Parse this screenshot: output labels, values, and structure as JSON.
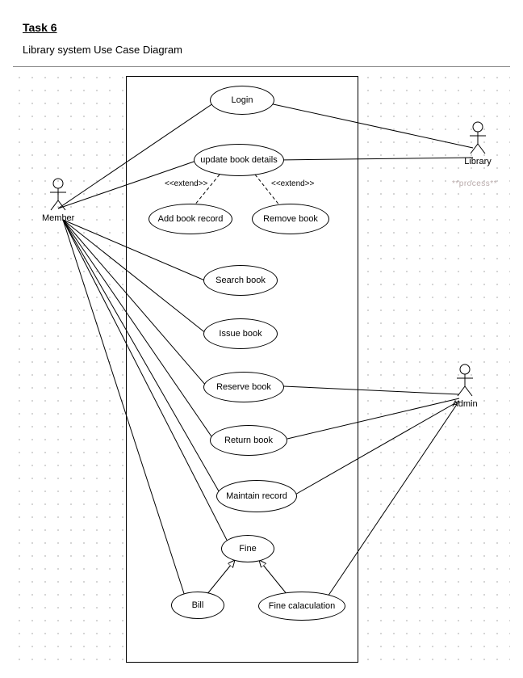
{
  "heading": "Task 6",
  "subheading": "Library system Use Case Diagram",
  "actors": {
    "member": "Member",
    "library": "Library",
    "admin": "Admin",
    "process_hint": "**process**"
  },
  "usecases": {
    "login": "Login",
    "update_details": "update book details",
    "add_record": "Add book record",
    "remove_book": "Remove book",
    "search_book": "Search book",
    "issue_book": "Issue book",
    "reserve_book": "Reserve book",
    "return_book": "Return book",
    "maintain_record": "Maintain record",
    "fine": "Fine",
    "bill": "Bill",
    "fine_calc": "Fine calaculation"
  },
  "stereotypes": {
    "extend_left": "<<extend>>",
    "extend_right": "<<extend>>"
  },
  "chart_data": {
    "type": "uml-use-case",
    "system": "Library system",
    "actors": [
      "Member",
      "Library",
      "Admin"
    ],
    "use_cases": [
      "Login",
      "update book details",
      "Add book record",
      "Remove book",
      "Search book",
      "Issue book",
      "Reserve book",
      "Return book",
      "Maintain record",
      "Fine",
      "Bill",
      "Fine calaculation"
    ],
    "associations": [
      {
        "actor": "Member",
        "use_case": "Login"
      },
      {
        "actor": "Member",
        "use_case": "update book details"
      },
      {
        "actor": "Member",
        "use_case": "Search book"
      },
      {
        "actor": "Member",
        "use_case": "Issue book"
      },
      {
        "actor": "Member",
        "use_case": "Reserve book"
      },
      {
        "actor": "Member",
        "use_case": "Return book"
      },
      {
        "actor": "Member",
        "use_case": "Maintain record"
      },
      {
        "actor": "Member",
        "use_case": "Fine"
      },
      {
        "actor": "Member",
        "use_case": "Bill"
      },
      {
        "actor": "Library",
        "use_case": "Login"
      },
      {
        "actor": "Library",
        "use_case": "update book details"
      },
      {
        "actor": "Admin",
        "use_case": "Reserve book"
      },
      {
        "actor": "Admin",
        "use_case": "Return book"
      },
      {
        "actor": "Admin",
        "use_case": "Maintain record"
      },
      {
        "actor": "Admin",
        "use_case": "Fine calaculation"
      }
    ],
    "extends": [
      {
        "from": "Add book record",
        "to": "update book details"
      },
      {
        "from": "Remove book",
        "to": "update book details"
      }
    ],
    "generalizations": [
      {
        "child": "Bill",
        "parent": "Fine"
      },
      {
        "child": "Fine calaculation",
        "parent": "Fine"
      }
    ]
  }
}
